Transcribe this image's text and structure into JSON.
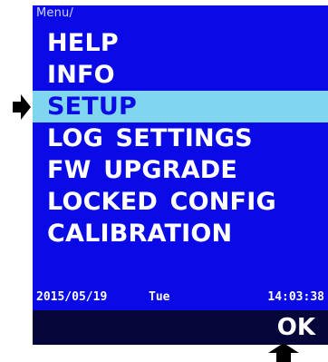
{
  "breadcrumb": "Menu/",
  "menu": {
    "items": [
      {
        "label": "HELP",
        "selected": false
      },
      {
        "label": "INFO",
        "selected": false
      },
      {
        "label": "SETUP",
        "selected": true
      },
      {
        "label": "LOG  SETTINGS",
        "selected": false
      },
      {
        "label": "FW  UPGRADE",
        "selected": false
      },
      {
        "label": "LOCKED  CONFIG",
        "selected": false
      },
      {
        "label": "CALIBRATION",
        "selected": false
      }
    ]
  },
  "status": {
    "date": "2015/05/19",
    "day": "Tue",
    "time": "14:03:38"
  },
  "softkey": {
    "ok_label": "OK"
  },
  "colors": {
    "screen_background": "#0a0ae6",
    "selection_highlight": "#7fd6ee",
    "softkey_bar": "#06063a",
    "text": "#ffffff"
  },
  "icons": {
    "pointer": "right-arrow-icon",
    "softkey_indicator": "up-arrow-icon"
  }
}
